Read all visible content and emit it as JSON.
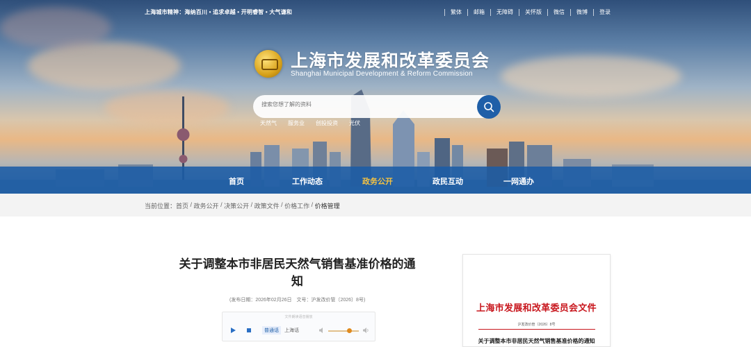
{
  "header": {
    "motto": "上海城市精神：海纳百川 • 追求卓越 • 开明睿智 • 大气谦和",
    "top_links": [
      "繁体",
      "邮箱",
      "无障碍",
      "关怀版",
      "微信",
      "微博",
      "登录"
    ],
    "title": "上海市发展和改革委员会",
    "subtitle": "Shanghai Municipal Development & Reform Commission"
  },
  "search": {
    "placeholder": "搜索您想了解的资料",
    "hot_keywords": [
      "天然气",
      "服务业",
      "创投投资",
      "光伏"
    ]
  },
  "nav": {
    "items": [
      "首页",
      "工作动态",
      "政务公开",
      "政民互动",
      "一网通办"
    ],
    "active": "政务公开"
  },
  "breadcrumb": {
    "label": "当前位置：",
    "items": [
      "首页",
      "政务公开",
      "决策公开",
      "政策文件",
      "价格工作"
    ],
    "current": "价格管理"
  },
  "article": {
    "title": "关于调整本市非居民天然气销售基准价格的通知",
    "meta": "(发布日期：2026年02月26日　文号：沪发改价管〔2026〕8号)"
  },
  "player": {
    "hint": "文件朗读语音播放",
    "dialect_mandarin": "普通话",
    "dialect_shanghai": "上海话",
    "volume": 0.7
  },
  "document_preview": {
    "heading": "上海市发展和改革委员会文件",
    "doc_number": "沪发改价管〔2026〕8号",
    "subject": "关于调整本市非居民天然气销售基准价格的通知"
  },
  "colors": {
    "nav_bg": "#1b5ca6",
    "nav_active": "#f5c242",
    "doc_red": "#c8161d",
    "search_button": "#1f5fa8"
  }
}
